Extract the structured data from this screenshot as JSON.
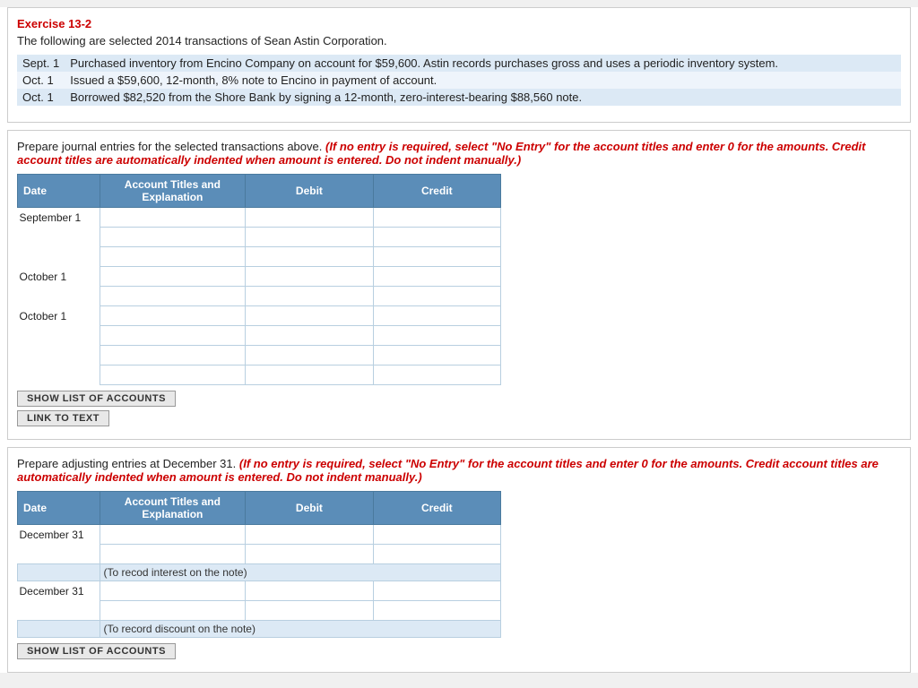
{
  "exercise": {
    "title": "Exercise 13-2",
    "intro": "The following are selected 2014 transactions of Sean Astin Corporation.",
    "transactions": [
      {
        "date": "Sept. 1",
        "description": "Purchased inventory from Encino Company on account for $59,600. Astin records purchases gross and uses a periodic inventory system."
      },
      {
        "date": "Oct. 1",
        "description": "Issued a $59,600, 12-month, 8% note to Encino in payment of account."
      },
      {
        "date": "Oct. 1",
        "description": "Borrowed $82,520 from the Shore Bank by signing a 12-month, zero-interest-bearing $88,560 note."
      }
    ]
  },
  "journal_section_1": {
    "instruction_normal": "Prepare journal entries for the selected transactions above.",
    "instruction_italic": "(If no entry is required, select \"No Entry\" for the account titles and enter 0 for the amounts. Credit account titles are automatically indented when amount is entered. Do not indent manually.)",
    "table_headers": {
      "date": "Date",
      "account": "Account Titles and Explanation",
      "debit": "Debit",
      "credit": "Credit"
    },
    "rows": [
      {
        "label": "September 1",
        "sub_rows": 3
      },
      {
        "label": "October 1",
        "sub_rows": 2
      },
      {
        "label": "October 1",
        "sub_rows": 4
      }
    ],
    "buttons": [
      {
        "id": "show-list-btn-1",
        "label": "SHOW LIST OF ACCOUNTS"
      },
      {
        "id": "link-to-text-btn-1",
        "label": "LINK TO TEXT"
      }
    ]
  },
  "journal_section_2": {
    "instruction_normal": "Prepare adjusting entries at December 31.",
    "instruction_italic": "(If no entry is required, select \"No Entry\" for the account titles and enter 0 for the amounts. Credit account titles are automatically indented when amount is entered. Do not indent manually.)",
    "table_headers": {
      "date": "Date",
      "account": "Account Titles and Explanation",
      "debit": "Debit",
      "credit": "Credit"
    },
    "entry_groups": [
      {
        "label": "December 31",
        "rows": 2,
        "note": "(To recod interest on the note)"
      },
      {
        "label": "December 31",
        "rows": 2,
        "note": "(To record discount on the note)"
      }
    ],
    "buttons": [
      {
        "id": "show-list-btn-2",
        "label": "SHOW LIST OF ACCOUNTS"
      }
    ]
  }
}
